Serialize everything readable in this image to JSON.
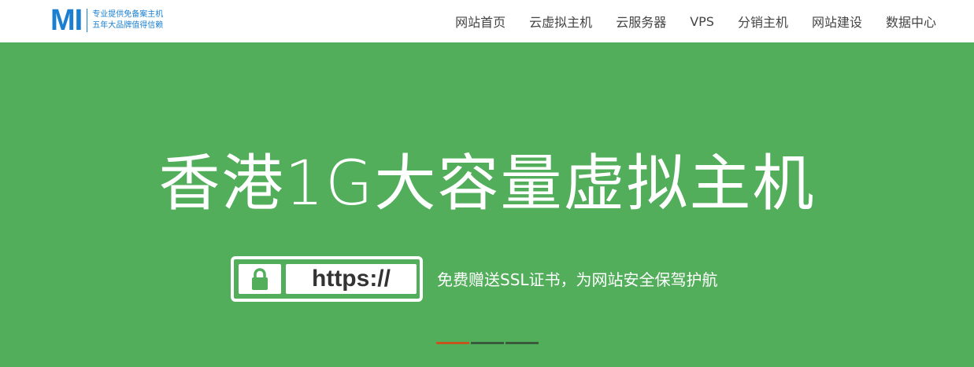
{
  "logo": {
    "mark": "MI",
    "line1": "专业提供免备案主机",
    "line2": "五年大品牌值得信赖"
  },
  "nav": [
    {
      "label": "网站首页"
    },
    {
      "label": "云虚拟主机"
    },
    {
      "label": "云服务器"
    },
    {
      "label": "VPS"
    },
    {
      "label": "分销主机"
    },
    {
      "label": "网站建设"
    },
    {
      "label": "数据中心"
    }
  ],
  "hero": {
    "title": "香港1G大容量虚拟主机",
    "badge_text": "https://",
    "subtitle": "免费赠送SSL证书，为网站安全保驾护航",
    "background": "#52ae5b",
    "slides": 3,
    "active_slide": 1
  },
  "icons": {
    "lock": "lock-icon"
  }
}
